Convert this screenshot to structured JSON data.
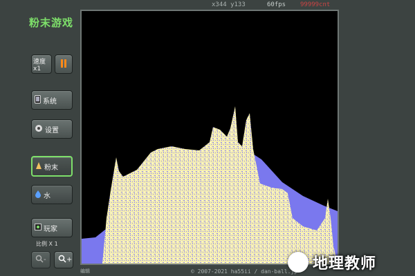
{
  "status": {
    "coords": "x344 y133",
    "fps": "60fps",
    "count": "99999cnt"
  },
  "app": {
    "title": "粉末游戏"
  },
  "toolbar": {
    "speed_label": "速度x1",
    "system_label": "系统",
    "settings_label": "设置",
    "powder_label": "粉末",
    "water_label": "水",
    "player_label": "玩家",
    "zoom_label": "比例 X 1",
    "zoom_out_label": "-",
    "zoom_in_label": "+"
  },
  "footer": {
    "left_text": "编辑",
    "credit": "© 2007-2021 ha55ii / dan-ball.jp"
  },
  "watermark": {
    "text": "地理教师"
  },
  "colors": {
    "powder": "#f5eeb0",
    "water": "#7a78ee",
    "accent": "#7ee06a",
    "pause": "#ff8a1a"
  }
}
